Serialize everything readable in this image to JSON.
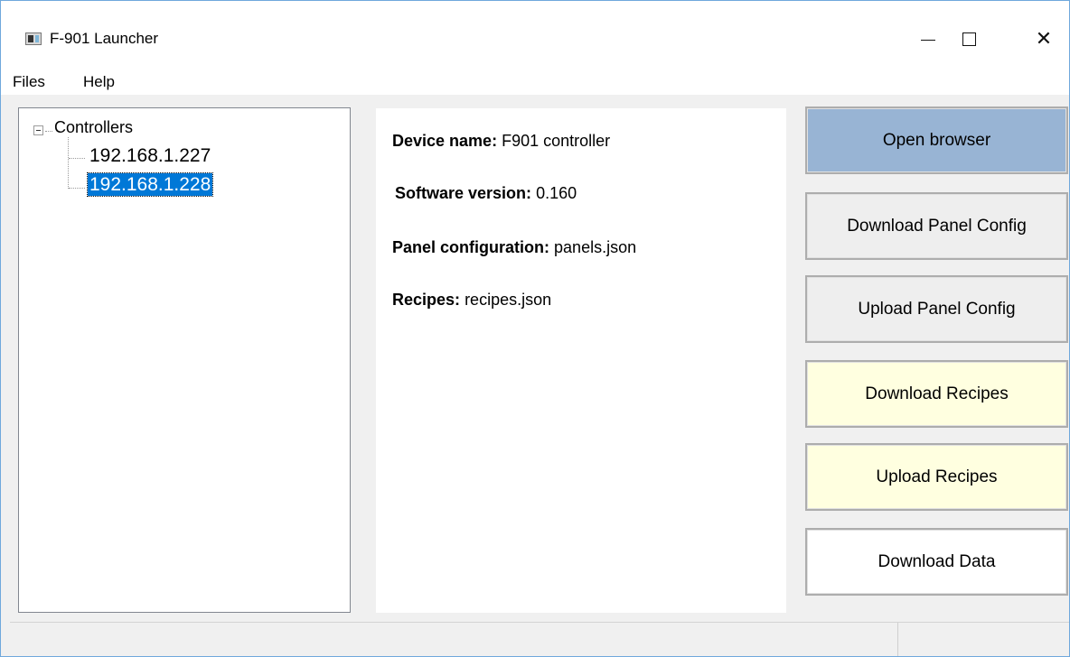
{
  "window": {
    "title": "F-901 Launcher",
    "app_icon": "app-window-icon",
    "controls": {
      "minimize": "minimize-icon",
      "maximize": "maximize-icon",
      "close_glyph": "✕"
    }
  },
  "menu": {
    "items": [
      {
        "label": "Files"
      },
      {
        "label": "Help"
      }
    ]
  },
  "tree": {
    "root": {
      "label": "Controllers",
      "expanded": true
    },
    "nodes": [
      {
        "label": "192.168.1.227",
        "selected": false
      },
      {
        "label": "192.168.1.228",
        "selected": true
      }
    ]
  },
  "details": {
    "device_name": {
      "label": "Device name:",
      "value": "F901 controller"
    },
    "software_version": {
      "label": "Software version:",
      "value": "0.160"
    },
    "panel_configuration": {
      "label": "Panel configuration:",
      "value": "panels.json"
    },
    "recipes": {
      "label": "Recipes:",
      "value": "recipes.json"
    }
  },
  "actions": {
    "open_browser": {
      "label": "Open browser",
      "color": "#98b4d4"
    },
    "download_panel_config": {
      "label": "Download Panel Config",
      "color": "#eeeeee"
    },
    "upload_panel_config": {
      "label": "Upload Panel Config",
      "color": "#eeeeee"
    },
    "download_recipes": {
      "label": "Download Recipes",
      "color": "#ffffe0"
    },
    "upload_recipes": {
      "label": "Upload Recipes",
      "color": "#ffffe0"
    },
    "download_data": {
      "label": "Download Data",
      "color": "#ffffff"
    }
  },
  "status": {
    "left": "",
    "right": ""
  },
  "colors": {
    "selection": "#0078d7",
    "window_border": "#6fa8dc"
  }
}
